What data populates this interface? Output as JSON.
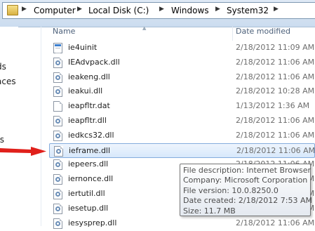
{
  "address_bar": {
    "crumbs": [
      "Computer",
      "Local Disk (C:)",
      "Windows",
      "System32"
    ],
    "separator": "▶",
    "icon": "folder-icon"
  },
  "nav_pane": {
    "partial_labels": [
      "ds",
      "aces",
      "ts"
    ]
  },
  "columns": {
    "name": "Name",
    "date_modified": "Date modified"
  },
  "files": [
    {
      "name": "ie4uinit",
      "date": "2/18/2012 11:09 AM",
      "icon": "application-icon"
    },
    {
      "name": "IEAdvpack.dll",
      "date": "2/18/2012 11:06 AM",
      "icon": "dll-icon"
    },
    {
      "name": "ieakeng.dll",
      "date": "2/18/2012 11:06 AM",
      "icon": "dll-icon"
    },
    {
      "name": "ieakui.dll",
      "date": "2/18/2012 10:28 AM",
      "icon": "dll-icon"
    },
    {
      "name": "ieapfltr.dat",
      "date": "1/13/2012 1:36 AM",
      "icon": "file-icon"
    },
    {
      "name": "ieapfltr.dll",
      "date": "2/18/2012 11:06 AM",
      "icon": "dll-icon"
    },
    {
      "name": "iedkcs32.dll",
      "date": "2/18/2012 11:06 AM",
      "icon": "dll-icon"
    },
    {
      "name": "ieframe.dll",
      "date": "2/18/2012 11:06 AM",
      "icon": "dll-icon",
      "selected": true
    },
    {
      "name": "iepeers.dll",
      "date": "2/18/2012 11:06 AM",
      "icon": "dll-icon"
    },
    {
      "name": "iernonce.dll",
      "date": "2/18/2012 11:06 AM",
      "icon": "dll-icon"
    },
    {
      "name": "iertutil.dll",
      "date": "2/18/2012 11:06 AM",
      "icon": "dll-icon"
    },
    {
      "name": "iesetup.dll",
      "date": "2/18/2012 11:06 AM",
      "icon": "dll-icon"
    },
    {
      "name": "iesysprep.dll",
      "date": "2/18/2012 11:06 AM",
      "icon": "dll-icon"
    }
  ],
  "tooltip": {
    "description": "File description: Internet Browser",
    "company": "Company: Microsoft Corporation",
    "version": "File version: 10.0.8250.0",
    "created": "Date created: 2/18/2012 7:53 AM",
    "size": "Size: 11.7 MB"
  },
  "annotation": {
    "icon": "red-arrow-icon",
    "color": "#e0201b"
  },
  "colors": {
    "selection_border": "#84acdd",
    "header_text": "#4c607a",
    "date_text": "#6d6d6d"
  }
}
